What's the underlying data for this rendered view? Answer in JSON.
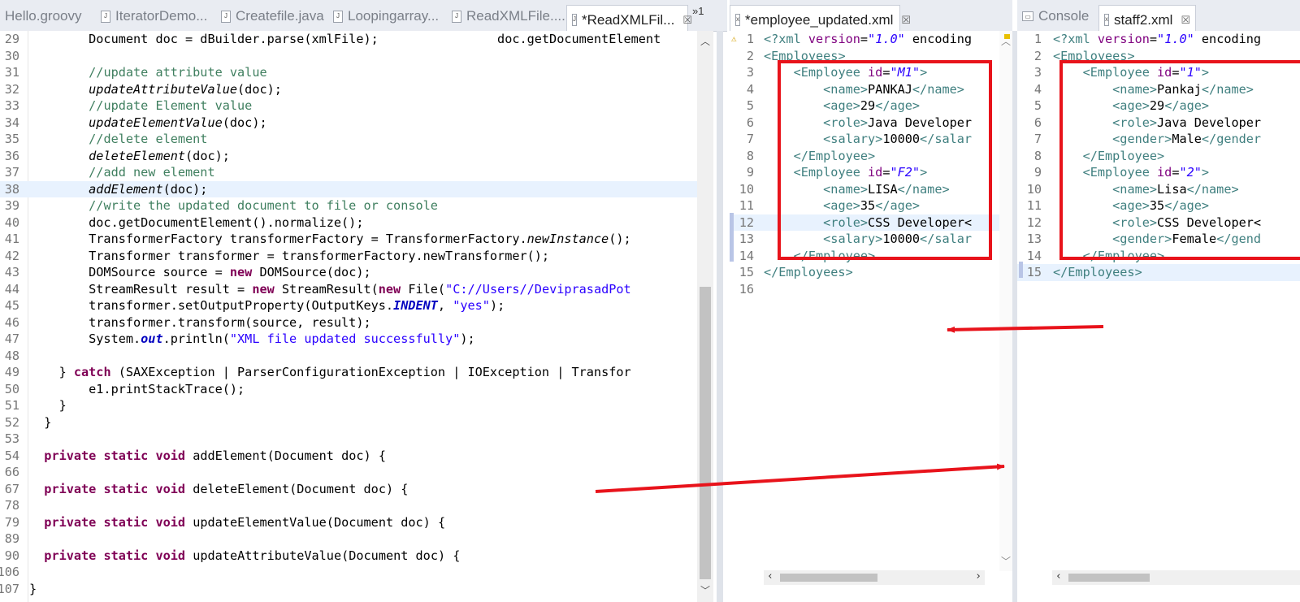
{
  "tabs_left": [
    {
      "label": "Hello.groovy"
    },
    {
      "label": "IteratorDemo..."
    },
    {
      "label": "Createfile.java"
    },
    {
      "label": "Loopingarray..."
    },
    {
      "label": "ReadXMLFile...."
    },
    {
      "label": "*ReadXMLFil..."
    }
  ],
  "overflow_label": "»1",
  "tab_middle": {
    "label": "*employee_updated.xml"
  },
  "tabs_right": [
    {
      "label": "Console"
    },
    {
      "label": "staff2.xml"
    }
  ],
  "java_lines": [
    {
      "n": "29",
      "t": "        Document doc = dBuilder.parse(xmlFile);                doc.getDocumentElement"
    },
    {
      "n": "30",
      "t": ""
    },
    {
      "n": "31",
      "t": "        //update attribute value"
    },
    {
      "n": "32",
      "t": "        updateAttributeValue(doc);"
    },
    {
      "n": "33",
      "t": "        //update Element value"
    },
    {
      "n": "34",
      "t": "        updateElementValue(doc);"
    },
    {
      "n": "35",
      "t": "        //delete element"
    },
    {
      "n": "36",
      "t": "        deleteElement(doc);"
    },
    {
      "n": "37",
      "t": "        //add new element"
    },
    {
      "n": "38",
      "t": "        addElement(doc);"
    },
    {
      "n": "39",
      "t": "        //write the updated document to file or console"
    },
    {
      "n": "40",
      "t": "        doc.getDocumentElement().normalize();"
    },
    {
      "n": "41",
      "t": "        TransformerFactory transformerFactory = TransformerFactory.newInstance();"
    },
    {
      "n": "42",
      "t": "        Transformer transformer = transformerFactory.newTransformer();"
    },
    {
      "n": "43",
      "t": "        DOMSource source = new DOMSource(doc);"
    },
    {
      "n": "44",
      "t": "        StreamResult result = new StreamResult(new File(\"C://Users//DeviprasadPot"
    },
    {
      "n": "45",
      "t": "        transformer.setOutputProperty(OutputKeys.INDENT, \"yes\");"
    },
    {
      "n": "46",
      "t": "        transformer.transform(source, result);"
    },
    {
      "n": "47",
      "t": "        System.out.println(\"XML file updated successfully\");"
    },
    {
      "n": "48",
      "t": ""
    },
    {
      "n": "49",
      "t": "    } catch (SAXException | ParserConfigurationException | IOException | Transfor"
    },
    {
      "n": "50",
      "t": "        e1.printStackTrace();"
    },
    {
      "n": "51",
      "t": "    }"
    },
    {
      "n": "52",
      "t": "  }"
    },
    {
      "n": "53",
      "t": ""
    },
    {
      "n": "54",
      "t": "  private static void addElement(Document doc) {"
    },
    {
      "n": "66",
      "t": ""
    },
    {
      "n": "67",
      "t": "  private static void deleteElement(Document doc) {"
    },
    {
      "n": "78",
      "t": ""
    },
    {
      "n": "79",
      "t": "  private static void updateElementValue(Document doc) {"
    },
    {
      "n": "89",
      "t": ""
    },
    {
      "n": "90",
      "t": "  private static void updateAttributeValue(Document doc) {"
    },
    {
      "n": "106",
      "t": ""
    },
    {
      "n": "107",
      "t": "}"
    }
  ],
  "xml_mid_lines": [
    {
      "n": "1",
      "t": "<?xml version=\"1.0\" encoding"
    },
    {
      "n": "2",
      "t": "<Employees>"
    },
    {
      "n": "3",
      "t": "    <Employee id=\"M1\">"
    },
    {
      "n": "4",
      "t": "        <name>PANKAJ</name>"
    },
    {
      "n": "5",
      "t": "        <age>29</age>"
    },
    {
      "n": "6",
      "t": "        <role>Java Developer"
    },
    {
      "n": "7",
      "t": "        <salary>10000</salar"
    },
    {
      "n": "8",
      "t": "    </Employee>"
    },
    {
      "n": "9",
      "t": "    <Employee id=\"F2\">"
    },
    {
      "n": "10",
      "t": "        <name>LISA</name>"
    },
    {
      "n": "11",
      "t": "        <age>35</age>"
    },
    {
      "n": "12",
      "t": "        <role>CSS Developer<"
    },
    {
      "n": "13",
      "t": "        <salary>10000</salar"
    },
    {
      "n": "14",
      "t": "    </Employee>"
    },
    {
      "n": "15",
      "t": "</Employees>"
    },
    {
      "n": "16",
      "t": ""
    }
  ],
  "xml_right_lines": [
    {
      "n": "1",
      "t": "<?xml version=\"1.0\" encoding"
    },
    {
      "n": "2",
      "t": "<Employees>"
    },
    {
      "n": "3",
      "t": "    <Employee id=\"1\">"
    },
    {
      "n": "4",
      "t": "        <name>Pankaj</name>"
    },
    {
      "n": "5",
      "t": "        <age>29</age>"
    },
    {
      "n": "6",
      "t": "        <role>Java Developer"
    },
    {
      "n": "7",
      "t": "        <gender>Male</gender"
    },
    {
      "n": "8",
      "t": "    </Employee>"
    },
    {
      "n": "9",
      "t": "    <Employee id=\"2\">"
    },
    {
      "n": "10",
      "t": "        <name>Lisa</name>"
    },
    {
      "n": "11",
      "t": "        <age>35</age>"
    },
    {
      "n": "12",
      "t": "        <role>CSS Developer<"
    },
    {
      "n": "13",
      "t": "        <gender>Female</gend"
    },
    {
      "n": "14",
      "t": "    </Employee>"
    },
    {
      "n": "15",
      "t": "</Employees>"
    }
  ],
  "colors": {
    "annotation_red": "#e8131b",
    "keyword": "#7f0055",
    "comment": "#3f7f5f",
    "string": "#2a00ff",
    "xml_tag": "#3f7f7f"
  }
}
